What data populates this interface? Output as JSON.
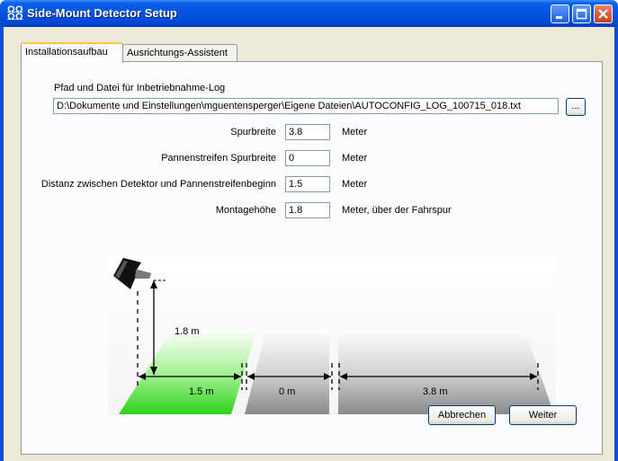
{
  "window": {
    "title": "Side-Mount Detector Setup"
  },
  "tabs": [
    {
      "label": "Installationsaufbau",
      "active": true
    },
    {
      "label": "Ausrichtungs-Assistent",
      "active": false
    }
  ],
  "log": {
    "label": "Pfad und Datei für Inbetriebnahme-Log",
    "path": "D:\\Dokumente und Einstellungen\\mguentensperger\\Eigene Dateien\\AUTOCONFIG_LOG_100715_018.txt",
    "browse_label": "..."
  },
  "fields": [
    {
      "label": "Spurbreite",
      "value": "3.8",
      "unit": "Meter"
    },
    {
      "label": "Pannenstreifen Spurbreite",
      "value": "0",
      "unit": "Meter"
    },
    {
      "label": "Distanz zwischen Detektor und Pannenstreifenbeginn",
      "value": "1.5",
      "unit": "Meter"
    },
    {
      "label": "Montagehöhe",
      "value": "1.8",
      "unit": "Meter, über der Fahrspur"
    }
  ],
  "diagram": {
    "height_label": "1.8 m",
    "distance_label": "1.5 m",
    "shoulder_label": "0 m",
    "lane_label": "3.8 m"
  },
  "buttons": {
    "cancel": "Abbrechen",
    "next": "Weiter"
  },
  "colors": {
    "accent_green": "#3ed92e",
    "lane_gray": "#8f8f8f",
    "title_blue": "#0054e3"
  }
}
